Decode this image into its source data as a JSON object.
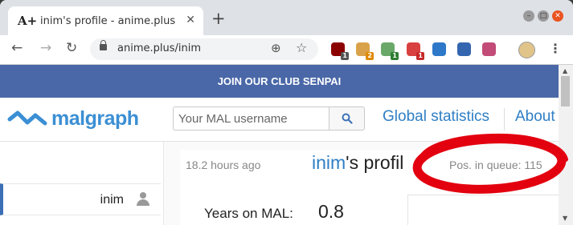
{
  "browser": {
    "tab_title": "inim's profile - anime.plus",
    "tab_favicon": "A+",
    "new_tab": "+",
    "url": "anime.plus/inim",
    "extensions": [
      {
        "name": "ublock",
        "color": "#8b0000",
        "badge": "1",
        "badge_color": "#555"
      },
      {
        "name": "ext-2",
        "color": "#d9a24a",
        "badge": "2",
        "badge_color": "#e08a00"
      },
      {
        "name": "ext-3",
        "color": "#6aa86a",
        "badge": "1",
        "badge_color": "#2e7d32"
      },
      {
        "name": "ext-4",
        "color": "#d94040",
        "badge": "1",
        "badge_color": "#c62828"
      },
      {
        "name": "ext-5",
        "color": "#2d78c8",
        "badge": "",
        "badge_color": ""
      },
      {
        "name": "ext-6",
        "color": "#3466b0",
        "badge": "",
        "badge_color": ""
      },
      {
        "name": "ext-7",
        "color": "#c24b78",
        "badge": "",
        "badge_color": ""
      }
    ]
  },
  "page": {
    "banner": "JOIN OUR CLUB SENPAI",
    "logo_text": "malgraph",
    "search_placeholder": "Your MAL username",
    "nav": {
      "global_statistics": "Global statistics",
      "about": "About"
    },
    "sidebar": {
      "username": "inim"
    },
    "profile": {
      "updated": "18.2 hours ago",
      "title_name": "inim",
      "title_suffix": "'s profil",
      "queue": "Pos. in queue: 115",
      "years_label": "Years on MAL:",
      "years_value": "0.8"
    }
  },
  "colors": {
    "banner": "#4a68a8",
    "link": "#2f7fc5",
    "annotation": "#e3000f"
  }
}
